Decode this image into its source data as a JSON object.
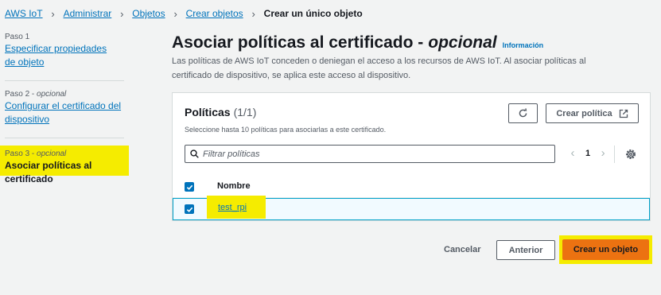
{
  "breadcrumb": {
    "items": [
      "AWS IoT",
      "Administrar",
      "Objetos",
      "Crear objetos"
    ],
    "current": "Crear un único objeto"
  },
  "steps": [
    {
      "num": "Paso 1",
      "optional": "",
      "title": "Especificar propiedades de objeto"
    },
    {
      "num": "Paso 2",
      "optional": "opcional",
      "title": "Configurar el certificado del dispositivo"
    },
    {
      "num": "Paso 3",
      "optional": "opcional",
      "title": "Asociar políticas al certificado"
    }
  ],
  "header": {
    "title": "Asociar políticas al certificado -",
    "optional": "opcional",
    "info_link": "Información",
    "description": "Las políticas de AWS IoT conceden o deniegan el acceso a los recursos de AWS IoT. Al asociar políticas al certificado de dispositivo, se aplica este acceso al dispositivo."
  },
  "policies": {
    "title": "Políticas",
    "count": "(1/1)",
    "subtitle": "Seleccione hasta 10 políticas para asociarlas a este certificado.",
    "create_button": "Crear política",
    "filter_placeholder": "Filtrar políticas",
    "page": "1",
    "column_name": "Nombre",
    "rows": [
      {
        "name": "test_rpi",
        "selected": true
      }
    ]
  },
  "actions": {
    "cancel": "Cancelar",
    "previous": "Anterior",
    "create": "Crear un objeto"
  },
  "colors": {
    "accent": "#0073bb",
    "primary_button": "#ec7211",
    "highlight": "#f5ec00",
    "background": "#f2f3f3"
  }
}
